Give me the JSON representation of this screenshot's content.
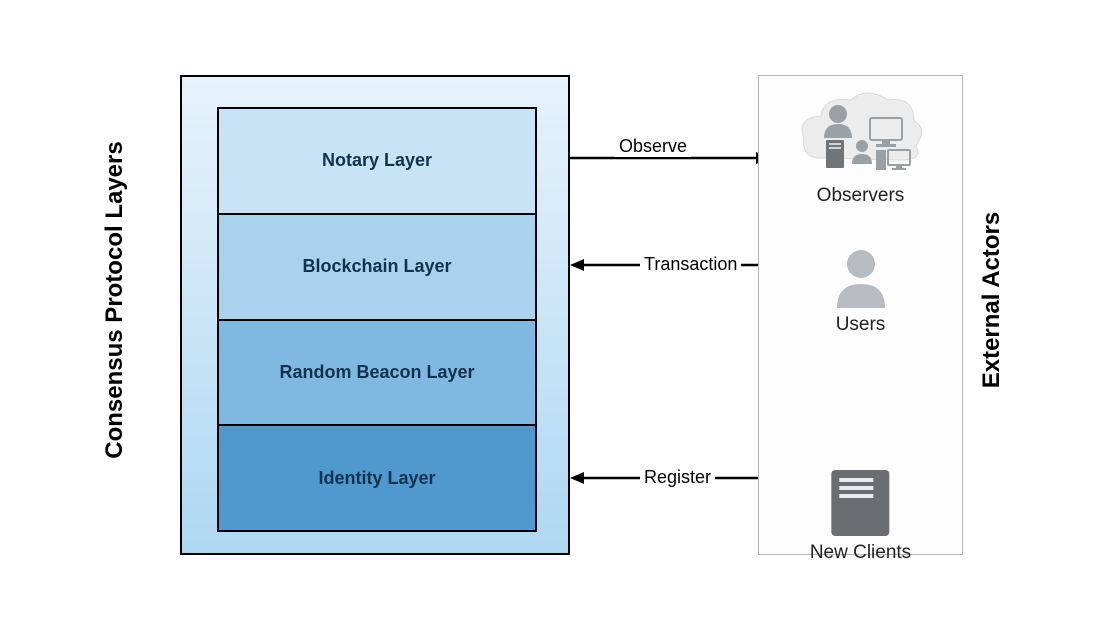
{
  "left": {
    "title": "Consensus Protocol Layers",
    "layers": {
      "notary": "Notary Layer",
      "blockchain": "Blockchain Layer",
      "beacon": "Random Beacon Layer",
      "identity": "Identity Layer"
    }
  },
  "right": {
    "title": "External Actors",
    "actors": {
      "observers": "Observers",
      "users": "Users",
      "newclients": "New Clients"
    }
  },
  "arrows": {
    "observe": "Observe",
    "transaction": "Transaction",
    "register": "Register"
  }
}
